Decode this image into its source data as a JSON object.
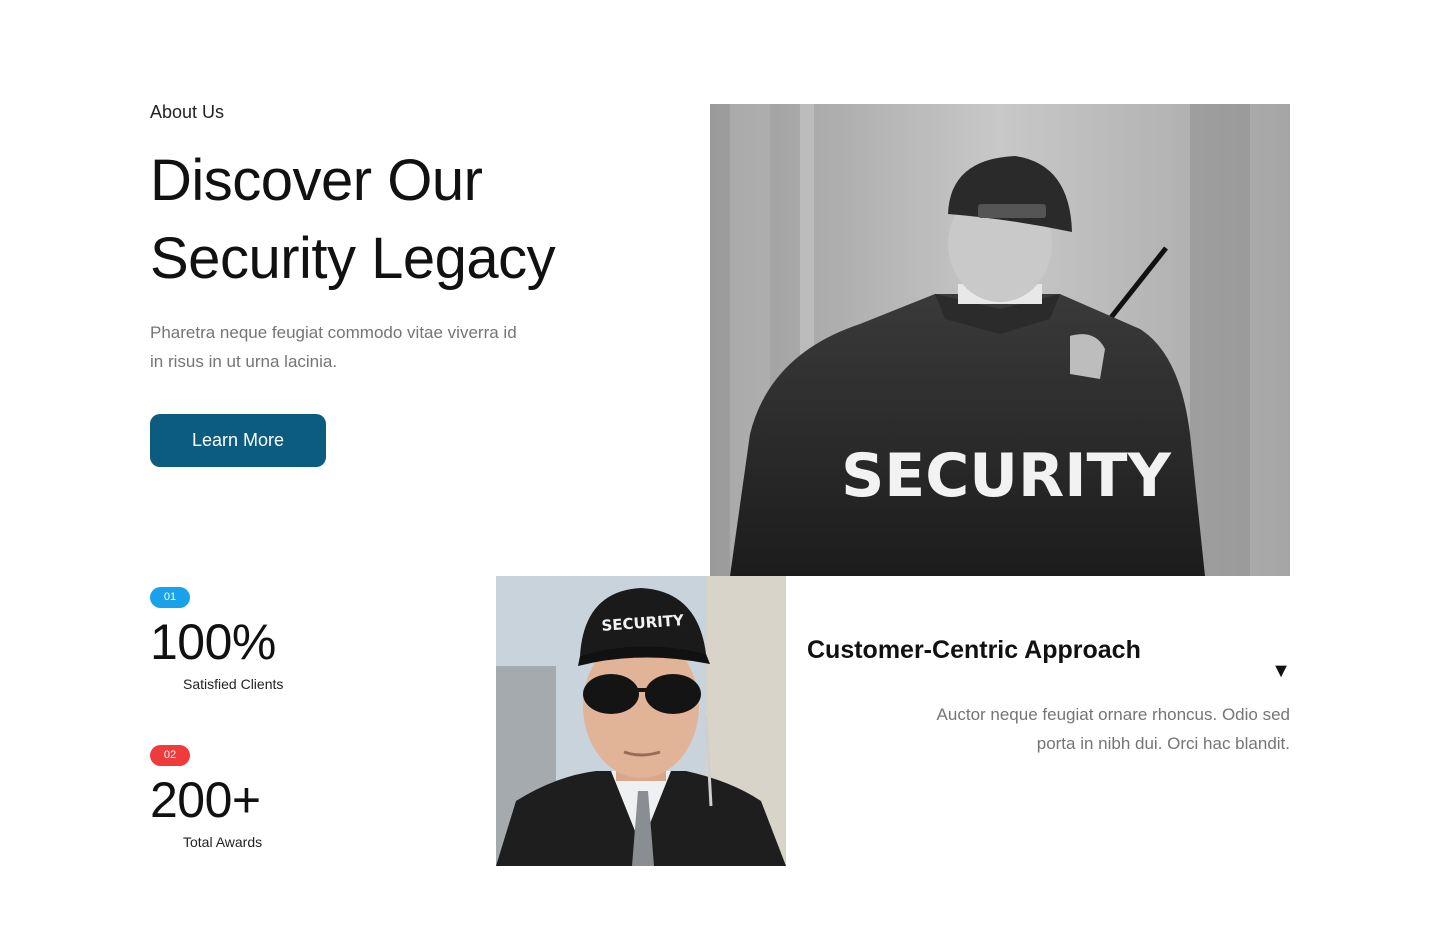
{
  "about": {
    "eyebrow": "About Us",
    "headline_line1": "Discover Our",
    "headline_line2": "Security Legacy",
    "lede": "Pharetra neque feugiat commodo vitae viverra id in risus in ut urna lacinia.",
    "cta_label": "Learn More"
  },
  "photos": {
    "main_jacket_text": "SECURITY",
    "guard_cap_text": "SECURITY"
  },
  "stats": [
    {
      "badge": "01",
      "value": "100%",
      "label": "Satisfied Clients",
      "badge_color": "#1aa1ec"
    },
    {
      "badge": "02",
      "value": "200+",
      "label": "Total Awards",
      "badge_color": "#ef3b3b"
    }
  ],
  "feature": {
    "title": "Customer-Centric Approach",
    "toggle_icon": "triangle-down-icon",
    "text": "Auctor neque feugiat ornare rhoncus. Odio sed porta in nibh dui. Orci hac blandit."
  },
  "colors": {
    "primary": "#0b5c7e",
    "text_muted": "#757575"
  }
}
